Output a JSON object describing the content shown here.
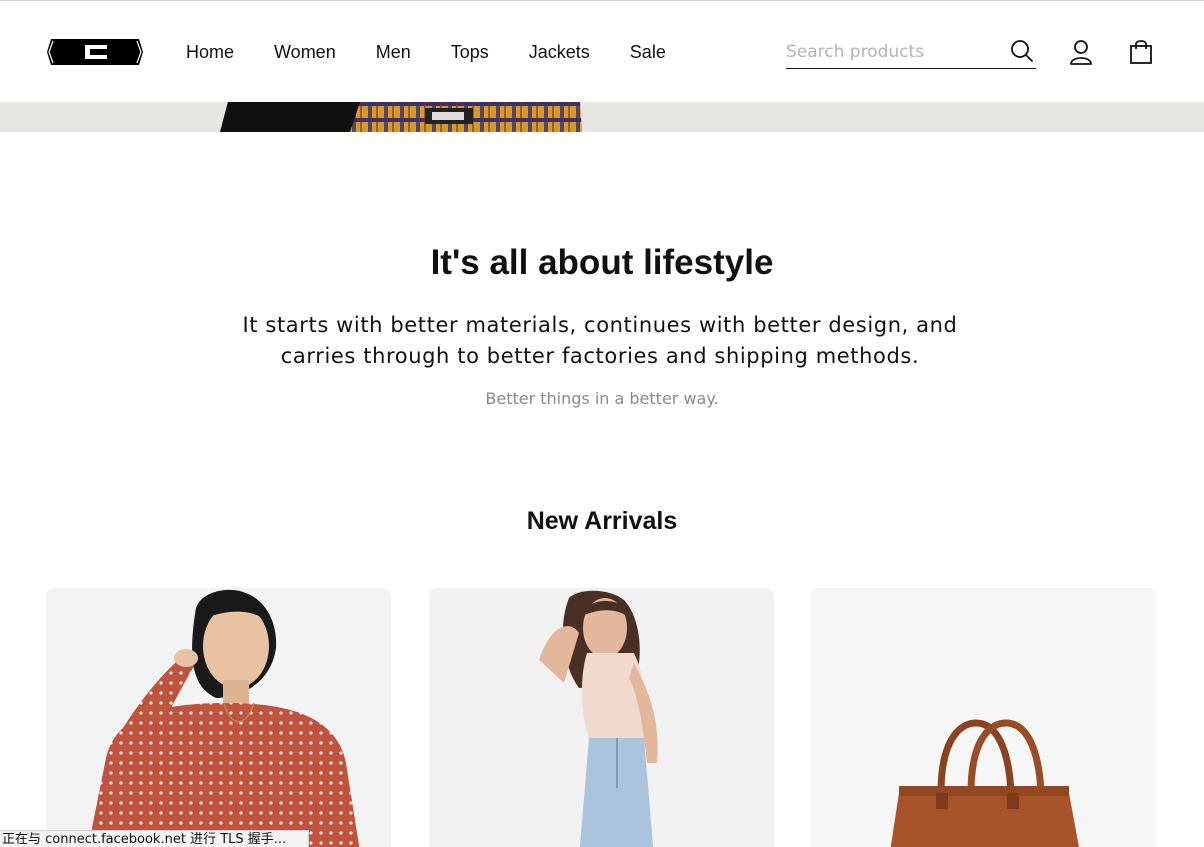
{
  "brand": {
    "logo_icon": "brand-logo-icon"
  },
  "nav": {
    "items": [
      {
        "label": "Home"
      },
      {
        "label": "Women"
      },
      {
        "label": "Men"
      },
      {
        "label": "Tops"
      },
      {
        "label": "Jackets"
      },
      {
        "label": "Sale"
      }
    ]
  },
  "search": {
    "placeholder": "Search products",
    "value": "",
    "icon": "search-icon"
  },
  "header_icons": {
    "account": "user-icon",
    "cart": "shopping-bag-icon"
  },
  "lifestyle": {
    "title": "It's all about lifestyle",
    "lead_line1": "It starts with better materials, continues with better design, and",
    "lead_line2": "carries through to better factories and shipping methods.",
    "tagline": "Better things in a better way."
  },
  "arrivals": {
    "title": "New Arrivals",
    "products": [
      {
        "image": "woman-red-sweater-photo"
      },
      {
        "image": "woman-denim-jeans-photo"
      },
      {
        "image": "brown-leather-tote-bag-photo"
      }
    ]
  },
  "status_bar": {
    "text": "正在与 connect.facebook.net 进行 TLS 握手..."
  },
  "colors": {
    "text": "#111111",
    "muted": "#8a8a8a",
    "placeholder": "#b3b3b3",
    "sweater": "#c0533e",
    "denim": "#a9c4dc",
    "leather": "#a8542a"
  }
}
